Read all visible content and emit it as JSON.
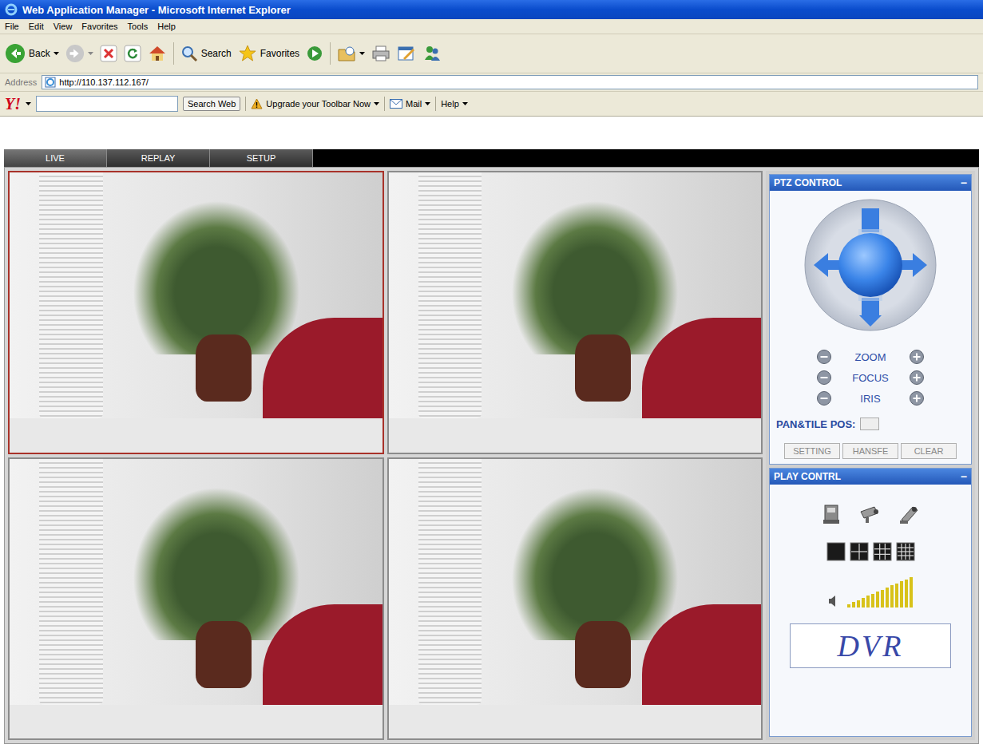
{
  "window": {
    "title": "Web Application Manager - Microsoft Internet Explorer"
  },
  "menu": [
    "File",
    "Edit",
    "View",
    "Favorites",
    "Tools",
    "Help"
  ],
  "toolbar": {
    "back": "Back",
    "search": "Search",
    "favorites": "Favorites"
  },
  "address": {
    "label": "Address",
    "url": "http://110.137.112.167/"
  },
  "yahoo_bar": {
    "logo": "Y!",
    "search_value": "",
    "search_button": "Search Web",
    "upgrade": "Upgrade your Toolbar Now",
    "mail": "Mail",
    "help": "Help"
  },
  "tabs": [
    {
      "label": "LIVE",
      "selected": true
    },
    {
      "label": "REPLAY",
      "selected": false
    },
    {
      "label": "SETUP",
      "selected": false
    }
  ],
  "channels": [
    {
      "selected": true
    },
    {
      "selected": false
    },
    {
      "selected": false
    },
    {
      "selected": false
    }
  ],
  "ptz": {
    "title": "PTZ CONTROL",
    "collapse": "−",
    "controls": [
      "ZOOM",
      "FOCUS",
      "IRIS"
    ],
    "position_label": "PAN&TILE POS:",
    "position_value": "",
    "buttons": [
      "SETTING",
      "HANSFE",
      "CLEAR"
    ]
  },
  "play": {
    "title": "PLAY CONTRL",
    "collapse": "−",
    "volume": {
      "level": 1
    }
  },
  "logo": "DVR"
}
